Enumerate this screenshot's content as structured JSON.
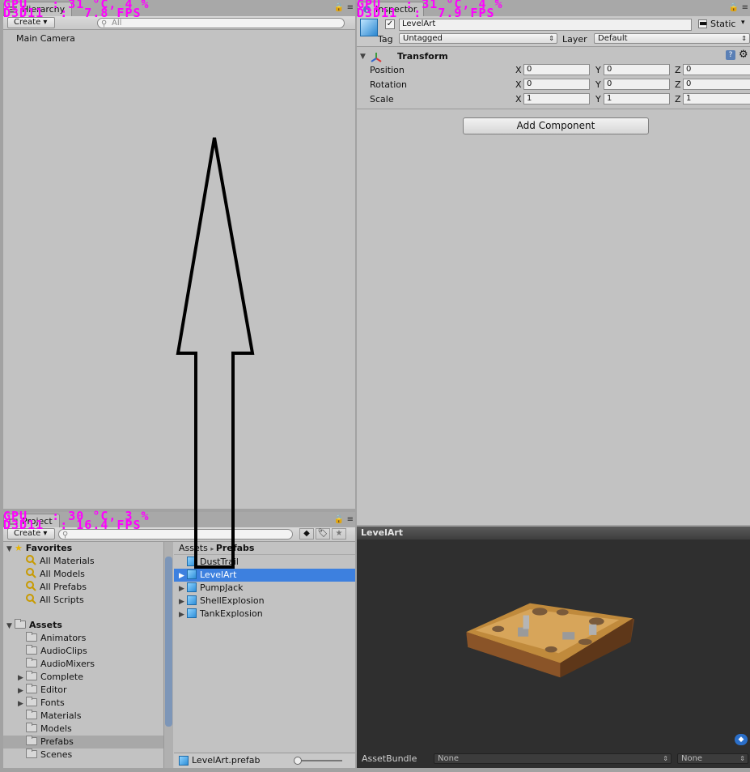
{
  "hierarchy": {
    "tab": "Hierarchy",
    "create": "Create",
    "search_placeholder": "All",
    "items": [
      "Main Camera"
    ]
  },
  "inspector": {
    "tab": "Inspector",
    "object_name": "LevelArt",
    "static_label": "Static",
    "tag_label": "Tag",
    "tag_value": "Untagged",
    "layer_label": "Layer",
    "layer_value": "Default",
    "transform": {
      "title": "Transform",
      "rows": [
        {
          "label": "Position",
          "x": "0",
          "y": "0",
          "z": "0"
        },
        {
          "label": "Rotation",
          "x": "0",
          "y": "0",
          "z": "0"
        },
        {
          "label": "Scale",
          "x": "1",
          "y": "1",
          "z": "1"
        }
      ]
    },
    "add_component": "Add Component"
  },
  "preview": {
    "title": "LevelArt",
    "assetbundle_label": "AssetBundle",
    "assetbundle_value": "None",
    "variant_value": "None"
  },
  "project": {
    "tab": "Project",
    "create": "Create",
    "favorites_label": "Favorites",
    "favorites": [
      "All Materials",
      "All Models",
      "All Prefabs",
      "All Scripts"
    ],
    "assets_label": "Assets",
    "folders": [
      {
        "name": "Animators",
        "expandable": false
      },
      {
        "name": "AudioClips",
        "expandable": false
      },
      {
        "name": "AudioMixers",
        "expandable": false
      },
      {
        "name": "Complete",
        "expandable": true
      },
      {
        "name": "Editor",
        "expandable": true
      },
      {
        "name": "Fonts",
        "expandable": true
      },
      {
        "name": "Materials",
        "expandable": false
      },
      {
        "name": "Models",
        "expandable": false
      },
      {
        "name": "Prefabs",
        "expandable": false
      },
      {
        "name": "Scenes",
        "expandable": false
      }
    ],
    "breadcrumb": [
      "Assets",
      "Prefabs"
    ],
    "prefabs": [
      {
        "name": "DustTrail",
        "expandable": false
      },
      {
        "name": "LevelArt",
        "expandable": true,
        "selected": true
      },
      {
        "name": "PumpJack",
        "expandable": true
      },
      {
        "name": "ShellExplosion",
        "expandable": true
      },
      {
        "name": "TankExplosion",
        "expandable": true
      }
    ],
    "footer_file": "LevelArt.prefab"
  },
  "overlays": {
    "hierarchy": "GPU   : 31 °C, 4 %\nD3D11  :  7.8 FPS",
    "inspector": "GPU   : 31 °C, 4 %\nD3D11  :  7.9 FPS",
    "project": "GPU   : 30 °C, 3 %\nD3D11  : 16.4 FPS"
  },
  "colors": {
    "selection": "#3d80df",
    "overlay": "#ff00ff",
    "preview_bg": "#2f2f2f"
  }
}
